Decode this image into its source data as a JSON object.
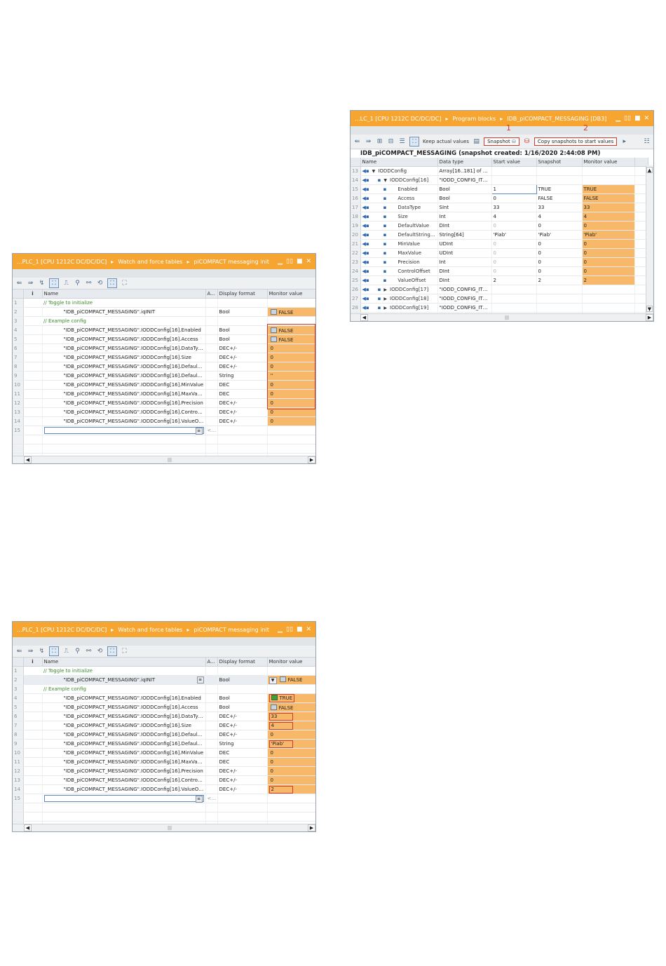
{
  "watch_table_initial": {
    "breadcrumb": [
      "...PLC_1 [CPU 1212C DC/DC/DC]",
      "Watch and force tables",
      "piCOMPACT messaging init"
    ],
    "columns": [
      "i",
      "Name",
      "A...",
      "Display format",
      "Monitor value"
    ],
    "rows": [
      {
        "num": "1",
        "type": "comment",
        "name": "// Toggle to initialize",
        "format": "",
        "value": ""
      },
      {
        "num": "2",
        "type": "var",
        "name": "\"IDB_piCOMPACT_MESSAGING\".iqINIT",
        "format": "Bool",
        "value": "FALSE",
        "check": "off"
      },
      {
        "num": "3",
        "type": "comment",
        "name": "// Example config",
        "format": "",
        "value": ""
      },
      {
        "num": "4",
        "type": "var",
        "name": "\"IDB_piCOMPACT_MESSAGING\".IODDConfig[16].Enabled",
        "format": "Bool",
        "value": "FALSE",
        "check": "off"
      },
      {
        "num": "5",
        "type": "var",
        "name": "\"IDB_piCOMPACT_MESSAGING\".IODDConfig[16].Access",
        "format": "Bool",
        "value": "FALSE",
        "check": "off"
      },
      {
        "num": "6",
        "type": "var",
        "name": "\"IDB_piCOMPACT_MESSAGING\".IODDConfig[16].DataType",
        "format": "DEC+/-",
        "value": "0"
      },
      {
        "num": "7",
        "type": "var",
        "name": "\"IDB_piCOMPACT_MESSAGING\".IODDConfig[16].Size",
        "format": "DEC+/-",
        "value": "0"
      },
      {
        "num": "8",
        "type": "var",
        "name": "\"IDB_piCOMPACT_MESSAGING\".IODDConfig[16].DefaultValue",
        "format": "DEC+/-",
        "value": "0"
      },
      {
        "num": "9",
        "type": "var",
        "name": "\"IDB_piCOMPACT_MESSAGING\".IODDConfig[16].DefaultStringValue",
        "format": "String",
        "value": "''"
      },
      {
        "num": "10",
        "type": "var",
        "name": "\"IDB_piCOMPACT_MESSAGING\".IODDConfig[16].MinValue",
        "format": "DEC",
        "value": "0"
      },
      {
        "num": "11",
        "type": "var",
        "name": "\"IDB_piCOMPACT_MESSAGING\".IODDConfig[16].MaxValue",
        "format": "DEC",
        "value": "0"
      },
      {
        "num": "12",
        "type": "var",
        "name": "\"IDB_piCOMPACT_MESSAGING\".IODDConfig[16].Precision",
        "format": "DEC+/-",
        "value": "0"
      },
      {
        "num": "13",
        "type": "var",
        "name": "\"IDB_piCOMPACT_MESSAGING\".IODDConfig[16].ControlOffset",
        "format": "DEC+/-",
        "value": "0"
      },
      {
        "num": "14",
        "type": "var",
        "name": "\"IDB_piCOMPACT_MESSAGING\".IODDConfig[16].ValueOffset",
        "format": "DEC+/-",
        "value": "0"
      },
      {
        "num": "15",
        "type": "edit",
        "name": "",
        "format": "<Ad",
        "value": ""
      }
    ]
  },
  "db_window": {
    "breadcrumb": [
      "...LC_1 [CPU 1212C DC/DC/DC]",
      "Program blocks",
      "IDB_piCOMPACT_MESSAGING [DB3]"
    ],
    "toolbar": {
      "keep_actual": "Keep actual values",
      "snapshot": "Snapshot",
      "copy": "Copy snapshots to start values"
    },
    "annotation_1": "1",
    "annotation_2": "2",
    "heading": "IDB_piCOMPACT_MESSAGING (snapshot created: 1/16/2020 2:44:08 PM)",
    "columns": [
      "Name",
      "Data type",
      "Start value",
      "Snapshot",
      "Monitor value"
    ],
    "rows": [
      {
        "num": "13",
        "lvl": 0,
        "expand": "▼",
        "name": "IODDConfig",
        "dtype": "Array[16..181] of \"I...",
        "start": "",
        "snap": "",
        "mon": ""
      },
      {
        "num": "14",
        "lvl": 1,
        "expand": "▼",
        "name": "IODDConfig[16]",
        "dtype": "\"IODD_CONFIG_ITE...",
        "start": "",
        "snap": "",
        "mon": ""
      },
      {
        "num": "15",
        "lvl": 2,
        "expand": "",
        "name": "Enabled",
        "dtype": "Bool",
        "start": "1",
        "snap": "TRUE",
        "mon": "TRUE",
        "active": true
      },
      {
        "num": "16",
        "lvl": 2,
        "expand": "",
        "name": "Access",
        "dtype": "Bool",
        "start": "0",
        "snap": "FALSE",
        "mon": "FALSE"
      },
      {
        "num": "17",
        "lvl": 2,
        "expand": "",
        "name": "DataType",
        "dtype": "SInt",
        "start": "33",
        "snap": "33",
        "mon": "33"
      },
      {
        "num": "18",
        "lvl": 2,
        "expand": "",
        "name": "Size",
        "dtype": "Int",
        "start": "4",
        "snap": "4",
        "mon": "4"
      },
      {
        "num": "19",
        "lvl": 2,
        "expand": "",
        "name": "DefaultValue",
        "dtype": "DInt",
        "start": "0",
        "snap": "0",
        "mon": "0",
        "dim": true
      },
      {
        "num": "20",
        "lvl": 2,
        "expand": "",
        "name": "DefaultStringV...",
        "dtype": "String[64]",
        "start": "'Piab'",
        "snap": "'Piab'",
        "mon": "'Piab'"
      },
      {
        "num": "21",
        "lvl": 2,
        "expand": "",
        "name": "MinValue",
        "dtype": "UDInt",
        "start": "0",
        "snap": "0",
        "mon": "0",
        "dim": true
      },
      {
        "num": "22",
        "lvl": 2,
        "expand": "",
        "name": "MaxValue",
        "dtype": "UDInt",
        "start": "0",
        "snap": "0",
        "mon": "0",
        "dim": true
      },
      {
        "num": "23",
        "lvl": 2,
        "expand": "",
        "name": "Precision",
        "dtype": "Int",
        "start": "0",
        "snap": "0",
        "mon": "0",
        "dim": true
      },
      {
        "num": "24",
        "lvl": 2,
        "expand": "",
        "name": "ControlOffset",
        "dtype": "DInt",
        "start": "0",
        "snap": "0",
        "mon": "0",
        "dim": true
      },
      {
        "num": "25",
        "lvl": 2,
        "expand": "",
        "name": "ValueOffset",
        "dtype": "DInt",
        "start": "2",
        "snap": "2",
        "mon": "2"
      },
      {
        "num": "26",
        "lvl": 1,
        "expand": "▶",
        "name": "IODDConfig[17]",
        "dtype": "\"IODD_CONFIG_ITE...",
        "start": "",
        "snap": "",
        "mon": ""
      },
      {
        "num": "27",
        "lvl": 1,
        "expand": "▶",
        "name": "IODDConfig[18]",
        "dtype": "\"IODD_CONFIG_ITE...",
        "start": "",
        "snap": "",
        "mon": ""
      },
      {
        "num": "28",
        "lvl": 1,
        "expand": "▶",
        "name": "IODDConfig[19]",
        "dtype": "\"IODD_CONFIG_ITE...",
        "start": "",
        "snap": "",
        "mon": ""
      },
      {
        "num": "29",
        "lvl": 1,
        "expand": "▶",
        "name": "IODDConfig[20]",
        "dtype": "\"IODD_CONFIG_ITE...",
        "start": "",
        "snap": "",
        "mon": ""
      }
    ]
  },
  "watch_table_after": {
    "breadcrumb": [
      "...PLC_1 [CPU 1212C DC/DC/DC]",
      "Watch and force tables",
      "piCOMPACT messaging init"
    ],
    "columns": [
      "i",
      "Name",
      "A...",
      "Display format",
      "Monitor value"
    ],
    "rows": [
      {
        "num": "1",
        "type": "comment",
        "name": "// Toggle to initialize",
        "format": "",
        "value": ""
      },
      {
        "num": "2",
        "type": "var",
        "name": "\"IDB_piCOMPACT_MESSAGING\".iqINIT",
        "format": "Bool",
        "value": "FALSE",
        "check": "off",
        "dropdown": true,
        "selected": true
      },
      {
        "num": "3",
        "type": "comment",
        "name": "// Example config",
        "format": "",
        "value": ""
      },
      {
        "num": "4",
        "type": "var",
        "name": "\"IDB_piCOMPACT_MESSAGING\".IODDConfig[16].Enabled",
        "format": "Bool",
        "value": "TRUE",
        "check": "on",
        "hl": true
      },
      {
        "num": "5",
        "type": "var",
        "name": "\"IDB_piCOMPACT_MESSAGING\".IODDConfig[16].Access",
        "format": "Bool",
        "value": "FALSE",
        "check": "off"
      },
      {
        "num": "6",
        "type": "var",
        "name": "\"IDB_piCOMPACT_MESSAGING\".IODDConfig[16].DataType",
        "format": "DEC+/-",
        "value": "33",
        "hl": true
      },
      {
        "num": "7",
        "type": "var",
        "name": "\"IDB_piCOMPACT_MESSAGING\".IODDConfig[16].Size",
        "format": "DEC+/-",
        "value": "4",
        "hl": true
      },
      {
        "num": "8",
        "type": "var",
        "name": "\"IDB_piCOMPACT_MESSAGING\".IODDConfig[16].DefaultValue",
        "format": "DEC+/-",
        "value": "0"
      },
      {
        "num": "9",
        "type": "var",
        "name": "\"IDB_piCOMPACT_MESSAGING\".IODDConfig[16].DefaultStringValue",
        "format": "String",
        "value": "'Piab'",
        "hl": true
      },
      {
        "num": "10",
        "type": "var",
        "name": "\"IDB_piCOMPACT_MESSAGING\".IODDConfig[16].MinValue",
        "format": "DEC",
        "value": "0"
      },
      {
        "num": "11",
        "type": "var",
        "name": "\"IDB_piCOMPACT_MESSAGING\".IODDConfig[16].MaxValue",
        "format": "DEC",
        "value": "0"
      },
      {
        "num": "12",
        "type": "var",
        "name": "\"IDB_piCOMPACT_MESSAGING\".IODDConfig[16].Precision",
        "format": "DEC+/-",
        "value": "0"
      },
      {
        "num": "13",
        "type": "var",
        "name": "\"IDB_piCOMPACT_MESSAGING\".IODDConfig[16].ControlOffset",
        "format": "DEC+/-",
        "value": "0"
      },
      {
        "num": "14",
        "type": "var",
        "name": "\"IDB_piCOMPACT_MESSAGING\".IODDConfig[16].ValueOffset",
        "format": "DEC+/-",
        "value": "2",
        "hl": true
      },
      {
        "num": "15",
        "type": "edit",
        "name": "",
        "format": "<Ad",
        "value": ""
      }
    ]
  },
  "colors": {
    "title_bar": "#f7a531",
    "monitor_fill": "#f7b86a",
    "highlight_border": "#d23a2a",
    "comment_text": "#3c8a2e"
  }
}
